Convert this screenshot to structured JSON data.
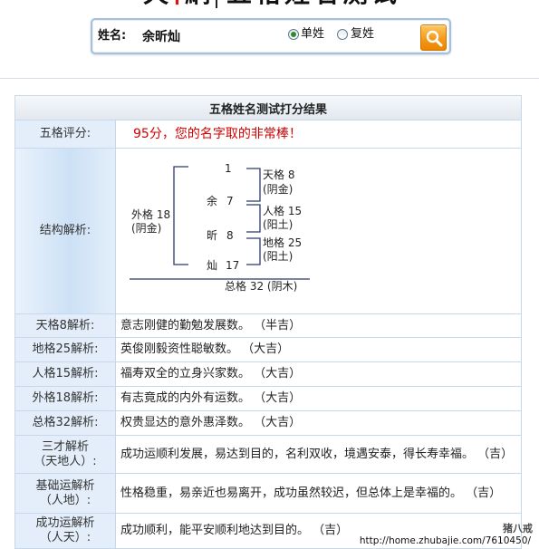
{
  "site_logo": {
    "brand_chars": [
      "天",
      "下",
      "網"
    ],
    "title": "五格姓名测试"
  },
  "search": {
    "name_label": "姓名:",
    "name_value": "余昕灿",
    "options": [
      {
        "label": "单姓",
        "selected": true
      },
      {
        "label": "复姓",
        "selected": false
      }
    ],
    "button_icon": "search-icon"
  },
  "result": {
    "title": "五格姓名测试打分结果",
    "score": {
      "label": "五格评分:",
      "value": "95分，您的名字取的非常棒！"
    },
    "structure": {
      "label": "结构解析:",
      "top_stroke": "1",
      "characters": [
        {
          "char": "余",
          "strokes": "7"
        },
        {
          "char": "昕",
          "strokes": "8"
        },
        {
          "char": "灿",
          "strokes": "17"
        }
      ],
      "waige": {
        "name": "外格 18",
        "wuxing": "(阴金)"
      },
      "tiange": {
        "name": "天格 8",
        "wuxing": "(阴金)"
      },
      "renge": {
        "name": "人格 15",
        "wuxing": "(阳土)"
      },
      "dige": {
        "name": "地格 25",
        "wuxing": "(阳土)"
      },
      "zongge": "总格 32 (阴木)"
    },
    "rows": [
      {
        "label": "天格8解析:",
        "text": "意志刚健的勤勉发展数。 （半吉）"
      },
      {
        "label": "地格25解析:",
        "text": "英俊刚毅资性聪敏数。 （大吉）"
      },
      {
        "label": "人格15解析:",
        "text": "福寿双全的立身兴家数。 （大吉）"
      },
      {
        "label": "外格18解析:",
        "text": "有志竟成的内外有运数。 （大吉）"
      },
      {
        "label": "总格32解析:",
        "text": "权贵显达的意外惠泽数。 （大吉）"
      },
      {
        "label_lines": [
          "三才解析",
          "（天地人）:"
        ],
        "text": "成功运顺利发展，易达到目的，名利双收，境遇安泰，得长寿幸福。 （吉）"
      },
      {
        "label_lines": [
          "基础运解析",
          "（人地）:"
        ],
        "text": "性格稳重，易亲近也易离开，成功虽然较迟，但总体上是幸福的。 （吉）"
      },
      {
        "label_lines": [
          "成功运解析",
          "（人天）:"
        ],
        "text": "成功顺利，能平安顺利地达到目的。 （吉）"
      }
    ]
  },
  "watermark": {
    "logo_text": "猪八戒",
    "url": "http://home.zhubajie.com/7610450/"
  },
  "colors": {
    "score_text": "#d40000",
    "label_cell_bg": "#e3eefa",
    "table_border": "#c6d8ea",
    "search_button": "#f39a1c",
    "radio_dot": "#2e8b2e",
    "logo_accent": "#e01010"
  }
}
